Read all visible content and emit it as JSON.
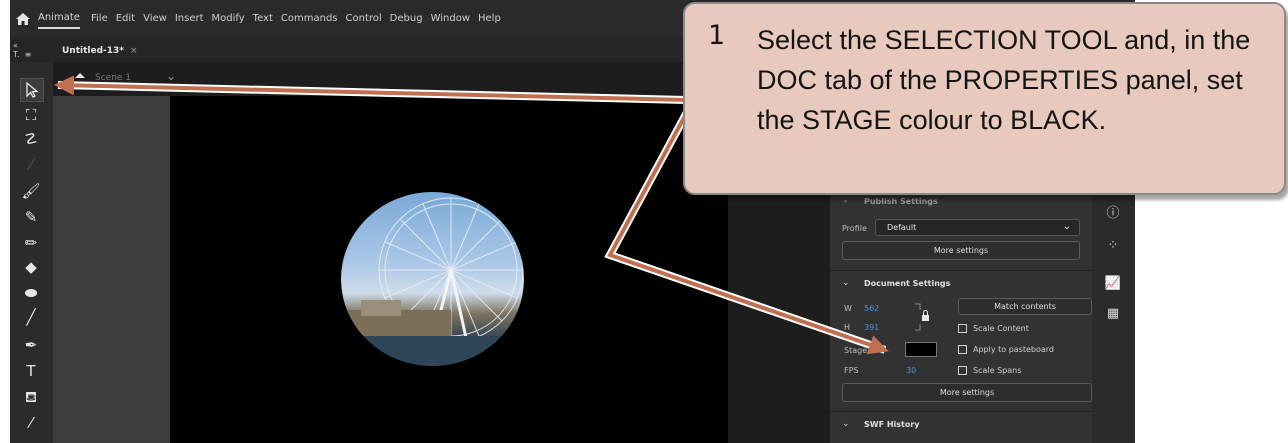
{
  "app": {
    "name": "Animate",
    "menu": [
      "File",
      "Edit",
      "View",
      "Insert",
      "Modify",
      "Text",
      "Commands",
      "Control",
      "Debug",
      "Window",
      "Help"
    ],
    "doc_tab": "Untitled-13*",
    "doc_tab_close": "×",
    "scene_label": "Scene 1"
  },
  "properties": {
    "publish_settings_title": "Publish Settings",
    "profile_label": "Profile",
    "profile_value": "Default",
    "more_settings_label": "More settings",
    "document_settings_title": "Document Settings",
    "w_label": "W",
    "w_value": "562",
    "h_label": "H",
    "h_value": "391",
    "match_contents_label": "Match contents",
    "scale_content_label": "Scale Content",
    "stage_label": "Stage",
    "stage_color": "#000000",
    "apply_pasteboard_label": "Apply to pasteboard",
    "fps_label": "FPS",
    "fps_value": "30",
    "scale_spans_label": "Scale Spans",
    "more_settings_label_2": "More settings",
    "swf_history_title": "SWF History"
  },
  "callout": {
    "number": "1",
    "text_part1": "Select the ",
    "text_bold1": "SELECTION TOOL",
    "text_part2": " and, in the DOC tab of the PROPERTIES panel, set the ",
    "text_bold2": "STAGE colour",
    "text_part3": " to BLACK."
  },
  "colors": {
    "callout_bg": "#e7c9bd",
    "arrow": "#c07050",
    "accent_blue": "#4d8fd9"
  }
}
